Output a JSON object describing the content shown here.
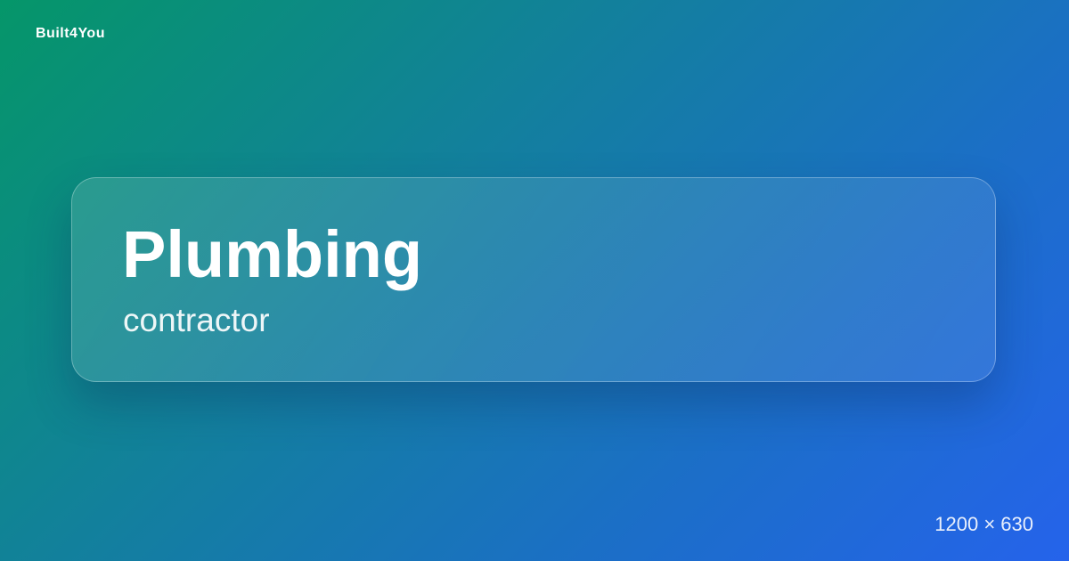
{
  "brand": {
    "name": "Built4You"
  },
  "card": {
    "title": "Plumbing",
    "subtitle": "contractor"
  },
  "footer": {
    "dimensions": "1200 × 630"
  },
  "colors": {
    "gradient_start": "#059669",
    "gradient_end": "#2563eb",
    "text": "#ffffff"
  }
}
